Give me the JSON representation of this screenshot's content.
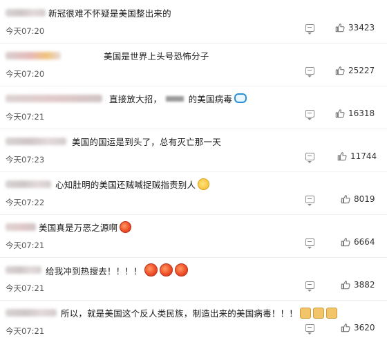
{
  "comments": [
    {
      "text": "新冠很难不怀疑是美国整出来的",
      "emojis": [],
      "time": "今天07:20",
      "likes": "33423",
      "blur": "plain"
    },
    {
      "text": "美国是世界上头号恐怖分子",
      "emojis": [],
      "time": "今天07:20",
      "likes": "25227",
      "blur": "accent"
    },
    {
      "text": "直接放大招，",
      "suffix": "的美国病毒",
      "emojis": [
        "drop"
      ],
      "time": "今天07:21",
      "likes": "16318",
      "blur": "acc2"
    },
    {
      "text": "美国的国运是到头了，总有灭亡那一天",
      "emojis": [],
      "time": "今天07:23",
      "likes": "11744",
      "blur": "plain"
    },
    {
      "text": "心知肚明的美国还贼喊捉贼指责别人",
      "emojis": [
        "sweat"
      ],
      "time": "今天07:22",
      "likes": "8019",
      "blur": "plain"
    },
    {
      "text": "美国真是万恶之源啊",
      "emojis": [
        "tomato"
      ],
      "time": "今天07:21",
      "likes": "6664",
      "blur": "acc2"
    },
    {
      "text": "给我冲到热搜去！！！！",
      "emojis": [
        "tomato",
        "tomato",
        "tomato"
      ],
      "time": "今天07:21",
      "likes": "3882",
      "blur": "plain"
    },
    {
      "text": "所以，就是美国这个反人类民族，制造出来的美国病毒！！！",
      "emojis": [
        "thumbdown",
        "thumbdown",
        "thumbdown"
      ],
      "time": "今天07:21",
      "likes": "3620",
      "blur": "plain"
    }
  ],
  "icons": {
    "comment": "comment-icon",
    "like": "thumbs-up-icon"
  }
}
